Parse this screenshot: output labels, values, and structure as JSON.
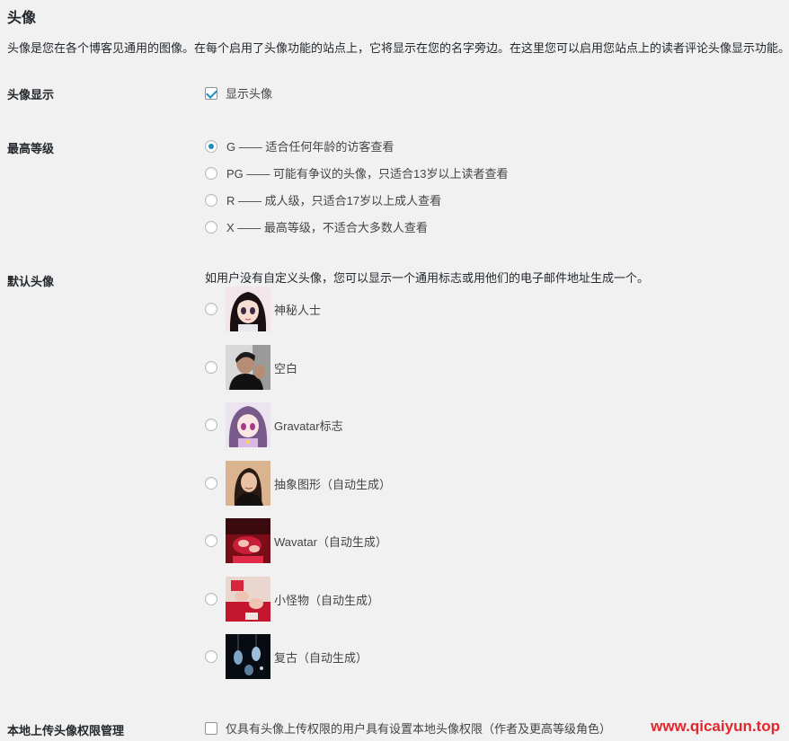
{
  "section": {
    "title": "头像",
    "description": "头像是您在各个博客见通用的图像。在每个启用了头像功能的站点上，它将显示在您的名字旁边。在这里您可以启用您站点上的读者评论头像显示功能。"
  },
  "avatar_display": {
    "label": "头像显示",
    "checkbox_label": "显示头像",
    "checked": true
  },
  "max_rating": {
    "label": "最高等级",
    "selected": "G",
    "options": [
      {
        "label": "G —— 适合任何年龄的访客查看"
      },
      {
        "label": "PG —— 可能有争议的头像，只适合13岁以上读者查看"
      },
      {
        "label": "R —— 成人级，只适合17岁以上成人查看"
      },
      {
        "label": "X —— 最高等级，不适合大多数人查看"
      }
    ]
  },
  "default_avatar": {
    "label": "默认头像",
    "description": "如用户没有自定义头像，您可以显示一个通用标志或用他们的电子邮件地址生成一个。",
    "options": [
      {
        "label": "神秘人士",
        "icon": "anime-girl-avatar-icon"
      },
      {
        "label": "空白",
        "icon": "man-portrait-avatar-icon"
      },
      {
        "label": "Gravatar标志",
        "icon": "anime-girl-purple-avatar-icon"
      },
      {
        "label": "抽象图形（自动生成）",
        "icon": "woman-portrait-avatar-icon"
      },
      {
        "label": "Wavatar（自动生成）",
        "icon": "red-hands-avatar-icon"
      },
      {
        "label": "小怪物（自动生成）",
        "icon": "red-hands-gift-avatar-icon"
      },
      {
        "label": "复古（自动生成）",
        "icon": "dark-figures-avatar-icon"
      }
    ]
  },
  "local_upload": {
    "label": "本地上传头像权限管理",
    "checkbox_label": "仅具有头像上传权限的用户具有设置本地头像权限（作者及更高等级角色）",
    "checked": false
  },
  "watermark": "www.qicaiyun.top",
  "colors": {
    "accent": "#1e8cbe",
    "background": "#f1f1f1",
    "watermark": "#e4262d"
  }
}
